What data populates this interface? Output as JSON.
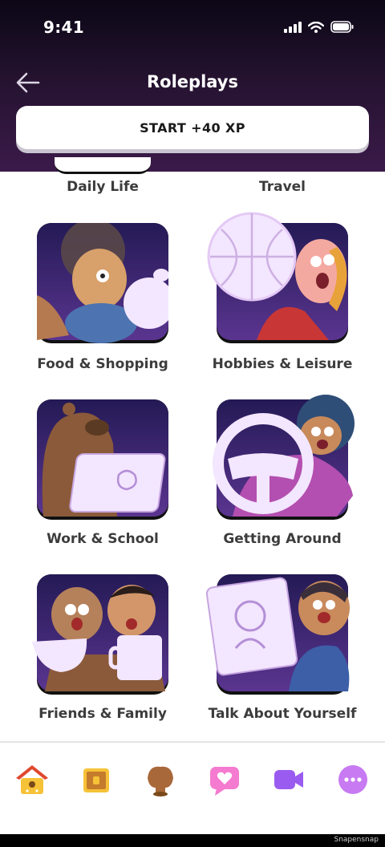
{
  "status_bar": {
    "time": "9:41"
  },
  "header": {
    "title": "Roleplays"
  },
  "start_button": {
    "label": "START +40 XP"
  },
  "categories_partial": [
    "Daily Life",
    "Travel"
  ],
  "categories": [
    {
      "label": "Food & Shopping",
      "icon": "apple-character-icon"
    },
    {
      "label": "Hobbies & Leisure",
      "icon": "basketball-character-icon"
    },
    {
      "label": "Work & School",
      "icon": "laptop-bear-icon"
    },
    {
      "label": "Getting Around",
      "icon": "steering-wheel-icon"
    },
    {
      "label": "Friends & Family",
      "icon": "coffee-cups-icon"
    },
    {
      "label": "Talk About Yourself",
      "icon": "portrait-frame-icon"
    }
  ],
  "nav": [
    "home-icon",
    "treasure-chest-icon",
    "shell-icon",
    "heart-chat-icon",
    "video-camera-icon",
    "more-icon"
  ],
  "footer": {
    "watermark": "Snapensnap"
  },
  "colors": {
    "header_dark": "#0b0716",
    "header_purple": "#3b1a4a",
    "tile_bg": "#2a1d5e",
    "label": "#3c3c3c"
  }
}
